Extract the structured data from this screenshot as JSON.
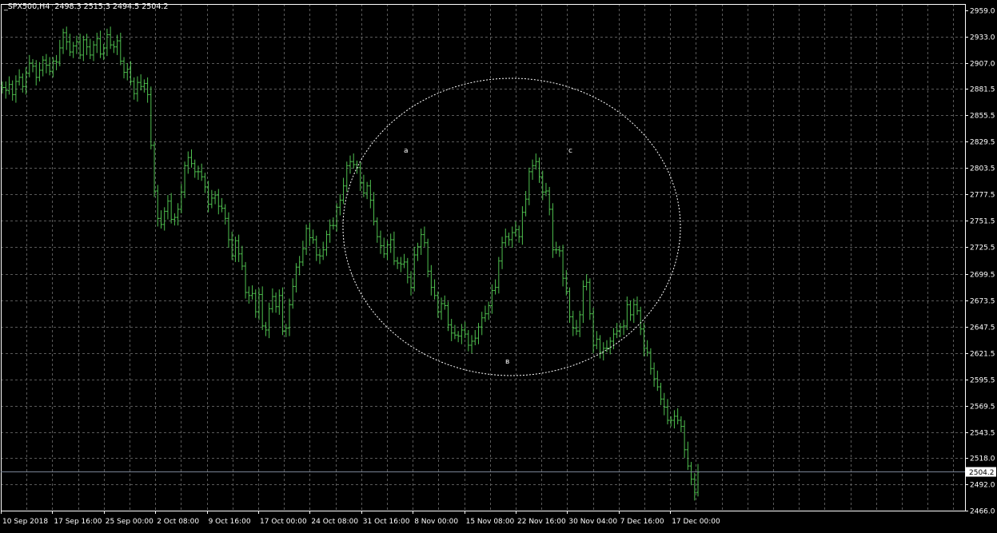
{
  "header": {
    "symbol_timeframe": "_SPX500,H4",
    "ohlc": "2498.3 2515.3 2494.5 2504.2"
  },
  "colors": {
    "background": "#000000",
    "grid": "#5a5a5a",
    "bars": "#4fc04f",
    "axis_text": "#ffffff",
    "price_line": "#7a8496",
    "circle": "#ffffff"
  },
  "chart_data": {
    "type": "line",
    "style": "ohlc-bars",
    "ylim": [
      2466.0,
      2959.0
    ],
    "yticks": [
      "2959.0",
      "2933.0",
      "2907.0",
      "2881.5",
      "2855.5",
      "2829.5",
      "2803.5",
      "2777.5",
      "2751.5",
      "2725.5",
      "2699.5",
      "2673.5",
      "2647.5",
      "2621.5",
      "2595.5",
      "2569.5",
      "2543.5",
      "2518.0",
      "2492.0",
      "2466.0"
    ],
    "xticks": [
      "10 Sep 2018",
      "17 Sep 16:00",
      "25 Sep 00:00",
      "2 Oct 08:00",
      "9 Oct 16:00",
      "17 Oct 00:00",
      "24 Oct 08:00",
      "31 Oct 16:00",
      "8 Nov 00:00",
      "15 Nov 08:00",
      "22 Nov 16:00",
      "30 Nov 04:00",
      "7 Dec 16:00",
      "17 Dec 00:00"
    ],
    "current_price": "2504.2",
    "grid": true,
    "series": [
      {
        "values": [
          2883,
          2880,
          2886,
          2876,
          2889,
          2893,
          2884,
          2897,
          2907,
          2904,
          2893,
          2900,
          2910,
          2905,
          2899,
          2909,
          2908,
          2922,
          2937,
          2928,
          2918,
          2924,
          2928,
          2915,
          2930,
          2923,
          2915,
          2925,
          2931,
          2916,
          2922,
          2935,
          2925,
          2923,
          2929,
          2909,
          2898,
          2901,
          2889,
          2877,
          2888,
          2884,
          2887,
          2876,
          2826,
          2781,
          2754,
          2748,
          2761,
          2771,
          2753,
          2755,
          2763,
          2780,
          2806,
          2814,
          2808,
          2800,
          2800,
          2795,
          2785,
          2768,
          2774,
          2777,
          2766,
          2764,
          2754,
          2733,
          2717,
          2732,
          2719,
          2707,
          2681,
          2678,
          2680,
          2662,
          2679,
          2648,
          2644,
          2665,
          2677,
          2667,
          2678,
          2643,
          2646,
          2669,
          2687,
          2706,
          2711,
          2724,
          2744,
          2735,
          2733,
          2718,
          2717,
          2723,
          2738,
          2747,
          2747,
          2765,
          2772,
          2786,
          2806,
          2810,
          2807,
          2804,
          2789,
          2779,
          2786,
          2772,
          2751,
          2736,
          2727,
          2719,
          2728,
          2733,
          2712,
          2710,
          2709,
          2711,
          2696,
          2686,
          2718,
          2726,
          2738,
          2730,
          2702,
          2686,
          2678,
          2662,
          2670,
          2668,
          2649,
          2641,
          2639,
          2638,
          2644,
          2640,
          2629,
          2633,
          2636,
          2647,
          2656,
          2660,
          2668,
          2683,
          2686,
          2712,
          2730,
          2736,
          2733,
          2740,
          2743,
          2736,
          2760,
          2773,
          2800,
          2806,
          2810,
          2795,
          2780,
          2781,
          2763,
          2723,
          2723,
          2722,
          2695,
          2682,
          2657,
          2646,
          2643,
          2659,
          2687,
          2691,
          2660,
          2629,
          2635,
          2622,
          2626,
          2626,
          2633,
          2640,
          2643,
          2647,
          2648,
          2669,
          2659,
          2669,
          2663,
          2645,
          2626,
          2622,
          2606,
          2596,
          2588,
          2576,
          2568,
          2555,
          2555,
          2559,
          2555,
          2549,
          2526,
          2510,
          2497,
          2484,
          2504
        ]
      }
    ],
    "annotations": [
      {
        "text": "a"
      },
      {
        "text": "в"
      },
      {
        "text": "c"
      }
    ]
  }
}
